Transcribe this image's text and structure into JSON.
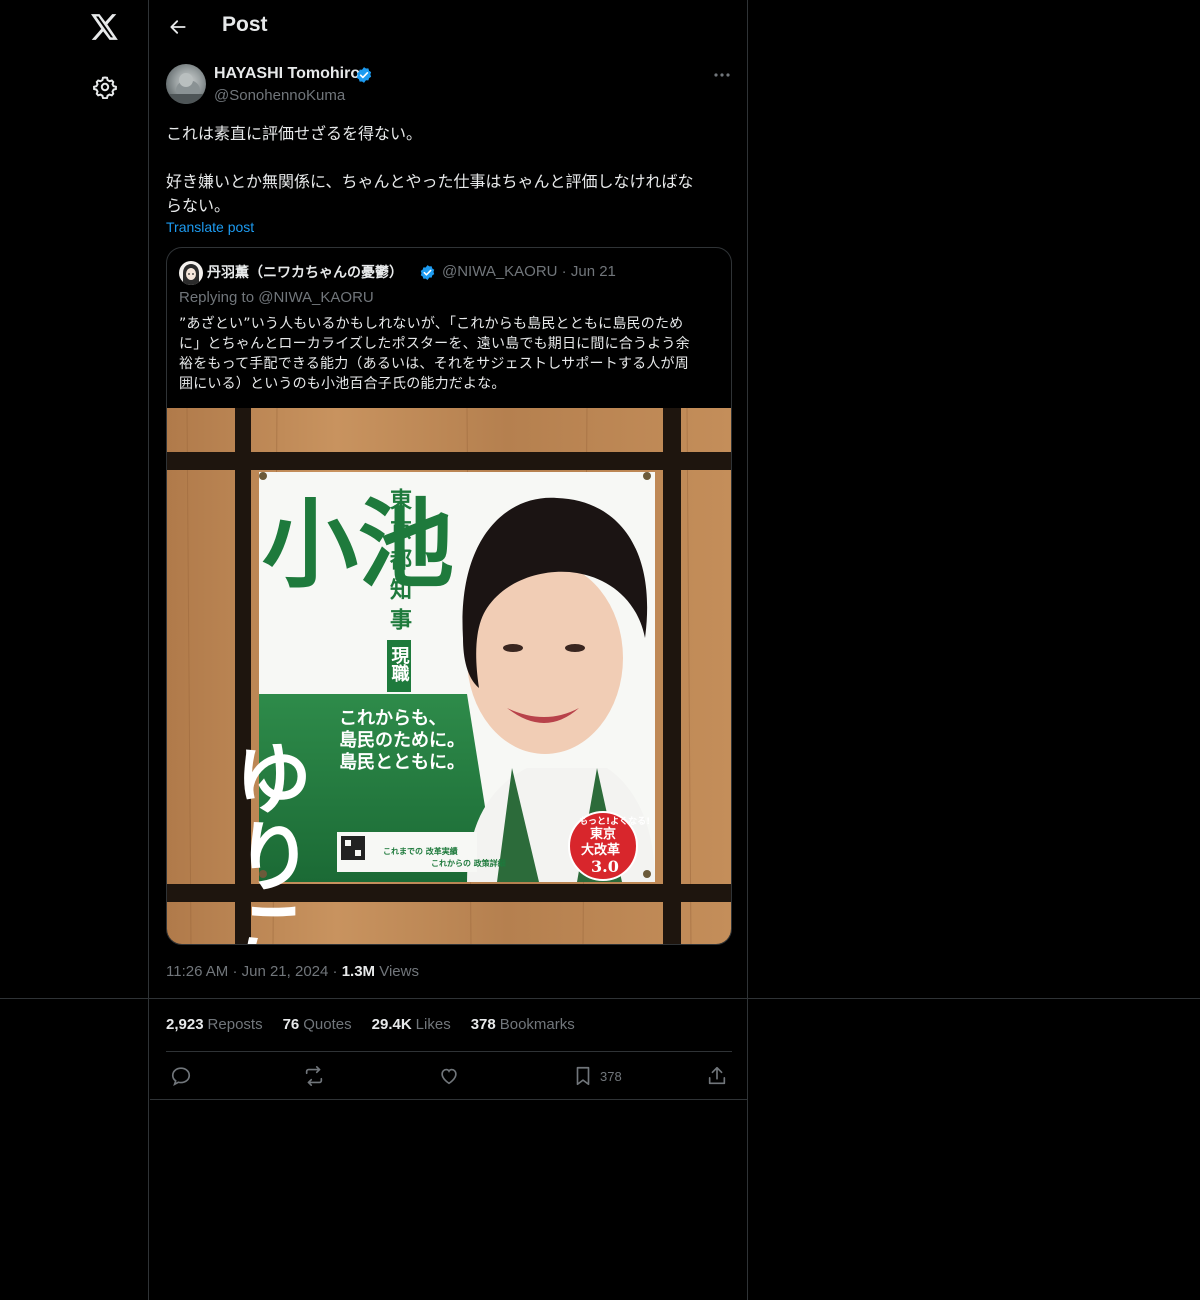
{
  "header": {
    "title": "Post"
  },
  "tweet": {
    "author_name": "HAYASHI Tomohiro",
    "author_handle": "@SonohennoKuma",
    "lines": [
      "これは素直に評価せざるを得ない。",
      "好き嫌いとか無関係に、ちゃんとやった仕事はちゃんと評価しなければな",
      "らない。"
    ],
    "translate_label": "Translate post",
    "time": "11:26 AM",
    "date": "Jun 21, 2024",
    "views_count": "1.3M",
    "views_label": "Views",
    "separator": "·"
  },
  "quote": {
    "author_name": "丹羽薫（ニワカちゃんの憂鬱）",
    "author_handle": "@NIWA_KAORU · Jun 21",
    "replying_to": "Replying to @NIWA_KAORU",
    "lines": [
      "”あざとい”いう人もいるかもしれないが、「これからも島民とともに島民のため",
      "に」とちゃんとローカライズしたポスターを、遠い島でも期日に間に合うよう余",
      "裕をもって手配できる能力（あるいは、それをサジェストしサポートする人が周",
      "囲にいる）というのも小池百合子氏の能力だよな。"
    ],
    "poster": {
      "big_name_1": "小池",
      "big_name_2": "ゆりこ",
      "vertical_title": "東京都知事",
      "badge": "現職",
      "slogan_1": "これからも、",
      "slogan_2": "島民のために。",
      "slogan_3": "島民とともに。",
      "seal_top": "もっと!よくなる!",
      "seal_mid_1": "東京",
      "seal_mid_2": "大改革",
      "seal_num": "3.0",
      "footer_1": "これまでの 改革実績",
      "footer_2": "これからの 政策詳細"
    }
  },
  "stats": {
    "reposts_count": "2,923",
    "reposts_label": "Reposts",
    "quotes_count": "76",
    "quotes_label": "Quotes",
    "likes_count": "29.4K",
    "likes_label": "Likes",
    "bookmarks_count": "378",
    "bookmarks_label": "Bookmarks"
  },
  "actions": {
    "bookmark_count": "378"
  },
  "colors": {
    "accent": "#1d9bf0",
    "background": "#000000",
    "border": "#2f3336",
    "muted": "#71767b",
    "poster_green": "#1e7a3c"
  },
  "icons": [
    "x-logo-icon",
    "gear-icon",
    "back-arrow-icon",
    "verified-badge-icon",
    "more-dots-icon",
    "reply-icon",
    "repost-icon",
    "like-icon",
    "bookmark-icon",
    "share-icon"
  ]
}
